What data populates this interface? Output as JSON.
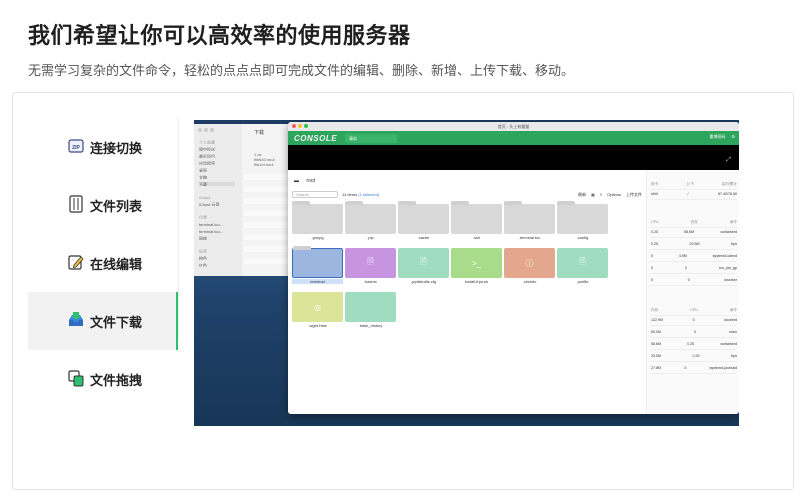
{
  "header": {
    "title": "我们希望让你可以高效率的使用服务器",
    "subtitle": "无需学习复杂的文件命令，轻松的点点点即可完成文件的编辑、删除、新增、上传下载、移动。"
  },
  "sidebar": {
    "items": [
      {
        "label": "连接切换"
      },
      {
        "label": "文件列表"
      },
      {
        "label": "在线编辑"
      },
      {
        "label": "文件下载"
      },
      {
        "label": "文件拖拽"
      }
    ]
  },
  "colors": {
    "accent": "#2fbf71",
    "console_green": "#2ea55c"
  },
  "app": {
    "logo": "CONSOLE",
    "tab_label": "青岛",
    "window_title": "首页 - 头上有猫猫",
    "path": "root",
    "search_placeholder": "Search",
    "items_count": "14 items",
    "selected": "(1 selected)",
    "tool_refresh": "刷新",
    "tool_options": "Options",
    "tool_upload": "上传文件",
    "nav_right": "重增密码"
  },
  "finder": {
    "title": "下载",
    "sidebar_items": [
      "个人收藏",
      "隔空投送",
      "最近项目",
      "应用程序",
      "桌面",
      "文稿",
      "下载",
      "iCloud",
      "iCloud 云盘",
      "位置",
      "terminal.tcu...",
      "terminal.tcu...",
      "网络",
      "标签",
      "橙色",
      "红色"
    ],
    "files": [
      "1.gz",
      "file640.mp4",
      "file1ef.mp4"
    ]
  },
  "files": [
    {
      "name": ".gnupg",
      "kind": "folder"
    },
    {
      "name": ".pip",
      "kind": "folder"
    },
    {
      "name": ".cache",
      "kind": "folder"
    },
    {
      "name": ".ssh",
      "kind": "folder"
    },
    {
      "name": ".terminal.tcu",
      "kind": "folder"
    },
    {
      "name": ".config",
      "kind": "folder"
    },
    {
      "name": "terminal",
      "kind": "folder-selected"
    },
    {
      "name": ".bashrc",
      "kind": "doc",
      "color": "#c795e0"
    },
    {
      "name": ".pydistutils.cfg",
      "kind": "doc",
      "color": "#9fdcc0"
    },
    {
      "name": "install-frps.sh",
      "kind": "shell",
      "color": "#a9dc8a"
    },
    {
      "name": ".viminfo",
      "kind": "info",
      "color": "#e3a78e"
    },
    {
      "name": ".profile",
      "kind": "doc",
      "color": "#9fdcc0"
    },
    {
      "name": ".wget-hsts",
      "kind": "doc",
      "color": "#dbe59a"
    },
    {
      "name": ".bash_history",
      "kind": "doc",
      "color": "#9fdcc0"
    }
  ],
  "monitor": {
    "net_header": [
      "网卡",
      "上/下",
      "实时/累计"
    ],
    "net_row": [
      "eth0",
      "/",
      "67.40/76.60"
    ],
    "proc_header": [
      "CPU",
      "内存",
      "命令"
    ],
    "proc_rows": [
      [
        "0.25",
        "58.6M",
        "containerd"
      ],
      [
        "0.25",
        "29.5M",
        "frps"
      ],
      [
        "0",
        "4.9M",
        "systemd-udevd"
      ],
      [
        "0",
        "0",
        "rcu_par_gp"
      ],
      [
        "0",
        "0",
        "kworker"
      ]
    ],
    "mem_header": [
      "内存",
      "CPU",
      "命令"
    ],
    "mem_rows": [
      [
        "122.9M",
        "0",
        "dockerd"
      ],
      [
        "60.0M",
        "0",
        "main"
      ],
      [
        "58.6M",
        "0.25",
        "containerd"
      ],
      [
        "29.5M",
        "0.25",
        "frps"
      ],
      [
        "27.8M",
        "0",
        "systemd-journald"
      ]
    ]
  }
}
